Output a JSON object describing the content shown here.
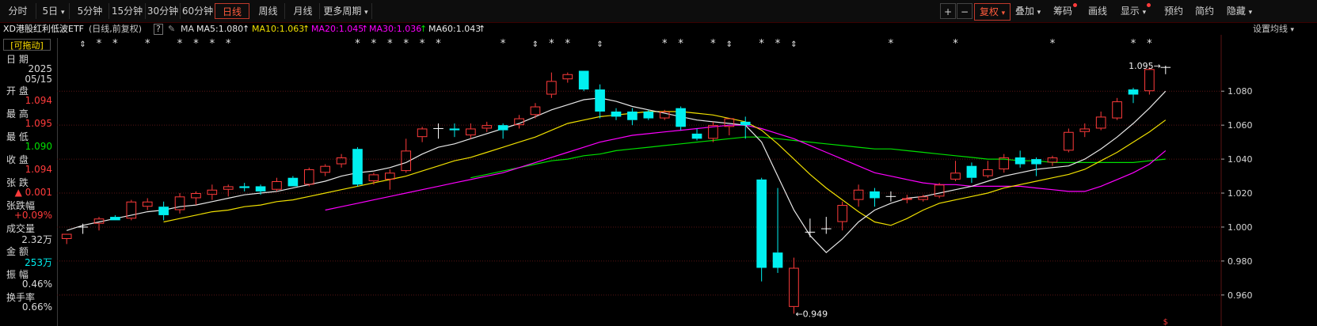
{
  "toolbar": {
    "periods": [
      "分时",
      "5日",
      "5分钟",
      "15分钟",
      "30分钟",
      "60分钟",
      "日线",
      "周线",
      "月线",
      "更多周期"
    ],
    "active_period": "日线",
    "plus_label": "+",
    "minus_label": "−",
    "fuquan_label": "复权",
    "overlay_label": "叠加",
    "chips_label": "筹码",
    "drawline_label": "画线",
    "display_label": "显示",
    "memo_label": "预约",
    "simple_label": "简约",
    "hide_label": "隐藏"
  },
  "ma_bar": {
    "title": "XD港股红利低波ETF",
    "mode": "(日线,前复权)",
    "help": "?",
    "ma_label": "MA",
    "ma5": "MA5:1.080",
    "ma10": "MA10:1.063",
    "ma20": "MA20:1.045",
    "ma30": "MA30:1.036",
    "ma60": "MA60:1.043",
    "settings": "设置均线"
  },
  "info_panel": {
    "drag": "[可拖动]",
    "date_label": "日  期",
    "date_year": "2025",
    "date_md": "05/15",
    "open_label": "开  盘",
    "open": "1.094",
    "high_label": "最  高",
    "high": "1.095",
    "low_label": "最  低",
    "low": "1.090",
    "close_label": "收  盘",
    "close": "1.094",
    "change_label": "张  跌",
    "change": "▲ 0.001",
    "pct_label": "张跌幅",
    "pct": "+0.09%",
    "vol_label": "成交量",
    "vol": "2.32万",
    "amount_label": "金  额",
    "amount": "253万",
    "amp_label": "振  幅",
    "amp": "0.46%",
    "turnover_label": "换手率",
    "turnover": "0.66%"
  },
  "colors": {
    "up": "#ff3b3b",
    "down": "#00f0f0",
    "flat": "#ffffff",
    "ma5": "#e8e8e8",
    "ma10": "#f0e000",
    "ma20": "#ff00ff",
    "ma60": "#00e000",
    "axis_text": "#d8d8d8",
    "active": "#ff5a3c"
  },
  "chart_data": {
    "type": "candlestick",
    "ylim": [
      0.952,
      1.102
    ],
    "yticks": [
      "1.080",
      "1.060",
      "1.040",
      "1.020",
      "1.000",
      "0.980",
      "0.960"
    ],
    "ytick_values": [
      1.08,
      1.06,
      1.04,
      1.02,
      1.0,
      0.98,
      0.96
    ],
    "max_label": "1.095",
    "max_value": 1.095,
    "min_label": "0.949",
    "min_value": 0.949,
    "s_marker": "$",
    "candles": [
      {
        "o": 0.993,
        "h": 0.996,
        "l": 0.99,
        "c": 0.996
      },
      {
        "o": 1.0,
        "h": 1.002,
        "l": 0.996,
        "c": 1.0
      },
      {
        "o": 1.002,
        "h": 1.006,
        "l": 0.998,
        "c": 1.005
      },
      {
        "o": 1.006,
        "h": 1.007,
        "l": 1.004,
        "c": 1.004
      },
      {
        "o": 1.005,
        "h": 1.016,
        "l": 1.004,
        "c": 1.015
      },
      {
        "o": 1.012,
        "h": 1.017,
        "l": 1.01,
        "c": 1.015
      },
      {
        "o": 1.012,
        "h": 1.015,
        "l": 1.004,
        "c": 1.007
      },
      {
        "o": 1.01,
        "h": 1.02,
        "l": 1.008,
        "c": 1.018
      },
      {
        "o": 1.017,
        "h": 1.021,
        "l": 1.013,
        "c": 1.02
      },
      {
        "o": 1.019,
        "h": 1.025,
        "l": 1.016,
        "c": 1.022
      },
      {
        "o": 1.022,
        "h": 1.025,
        "l": 1.018,
        "c": 1.024
      },
      {
        "o": 1.024,
        "h": 1.026,
        "l": 1.021,
        "c": 1.023
      },
      {
        "o": 1.024,
        "h": 1.025,
        "l": 1.019,
        "c": 1.021
      },
      {
        "o": 1.022,
        "h": 1.029,
        "l": 1.021,
        "c": 1.027
      },
      {
        "o": 1.029,
        "h": 1.03,
        "l": 1.024,
        "c": 1.024
      },
      {
        "o": 1.025,
        "h": 1.035,
        "l": 1.024,
        "c": 1.034
      },
      {
        "o": 1.032,
        "h": 1.037,
        "l": 1.03,
        "c": 1.036
      },
      {
        "o": 1.037,
        "h": 1.043,
        "l": 1.035,
        "c": 1.041
      },
      {
        "o": 1.046,
        "h": 1.047,
        "l": 1.024,
        "c": 1.025
      },
      {
        "o": 1.027,
        "h": 1.032,
        "l": 1.025,
        "c": 1.031
      },
      {
        "o": 1.028,
        "h": 1.034,
        "l": 1.022,
        "c": 1.032
      },
      {
        "o": 1.033,
        "h": 1.052,
        "l": 1.032,
        "c": 1.045
      },
      {
        "o": 1.053,
        "h": 1.059,
        "l": 1.05,
        "c": 1.058
      },
      {
        "o": 1.058,
        "h": 1.061,
        "l": 1.052,
        "c": 1.058
      },
      {
        "o": 1.058,
        "h": 1.061,
        "l": 1.053,
        "c": 1.057
      },
      {
        "o": 1.054,
        "h": 1.061,
        "l": 1.052,
        "c": 1.058
      },
      {
        "o": 1.058,
        "h": 1.062,
        "l": 1.056,
        "c": 1.06
      },
      {
        "o": 1.06,
        "h": 1.061,
        "l": 1.052,
        "c": 1.057
      },
      {
        "o": 1.06,
        "h": 1.066,
        "l": 1.058,
        "c": 1.064
      },
      {
        "o": 1.066,
        "h": 1.073,
        "l": 1.064,
        "c": 1.071
      },
      {
        "o": 1.078,
        "h": 1.091,
        "l": 1.076,
        "c": 1.086
      },
      {
        "o": 1.087,
        "h": 1.091,
        "l": 1.085,
        "c": 1.09
      },
      {
        "o": 1.092,
        "h": 1.092,
        "l": 1.08,
        "c": 1.081
      },
      {
        "o": 1.081,
        "h": 1.084,
        "l": 1.064,
        "c": 1.068
      },
      {
        "o": 1.068,
        "h": 1.07,
        "l": 1.063,
        "c": 1.065
      },
      {
        "o": 1.068,
        "h": 1.07,
        "l": 1.06,
        "c": 1.063
      },
      {
        "o": 1.068,
        "h": 1.069,
        "l": 1.063,
        "c": 1.064
      },
      {
        "o": 1.064,
        "h": 1.069,
        "l": 1.063,
        "c": 1.068
      },
      {
        "o": 1.07,
        "h": 1.071,
        "l": 1.057,
        "c": 1.059
      },
      {
        "o": 1.055,
        "h": 1.058,
        "l": 1.051,
        "c": 1.052
      },
      {
        "o": 1.052,
        "h": 1.062,
        "l": 1.05,
        "c": 1.06
      },
      {
        "o": 1.059,
        "h": 1.064,
        "l": 1.054,
        "c": 1.064
      },
      {
        "o": 1.062,
        "h": 1.065,
        "l": 1.052,
        "c": 1.06
      },
      {
        "o": 1.028,
        "h": 1.029,
        "l": 0.968,
        "c": 0.976
      },
      {
        "o": 0.985,
        "h": 1.023,
        "l": 0.973,
        "c": 0.976
      },
      {
        "o": 0.953,
        "h": 0.982,
        "l": 0.949,
        "c": 0.976
      },
      {
        "o": 0.997,
        "h": 1.005,
        "l": 0.994,
        "c": 0.997
      },
      {
        "o": 0.999,
        "h": 1.006,
        "l": 0.996,
        "c": 0.999
      },
      {
        "o": 1.003,
        "h": 1.015,
        "l": 0.998,
        "c": 1.013
      },
      {
        "o": 1.016,
        "h": 1.025,
        "l": 1.012,
        "c": 1.022
      },
      {
        "o": 1.021,
        "h": 1.023,
        "l": 1.012,
        "c": 1.017
      },
      {
        "o": 1.018,
        "h": 1.021,
        "l": 1.015,
        "c": 1.018
      },
      {
        "o": 1.016,
        "h": 1.019,
        "l": 1.014,
        "c": 1.017
      },
      {
        "o": 1.016,
        "h": 1.019,
        "l": 1.015,
        "c": 1.018
      },
      {
        "o": 1.018,
        "h": 1.026,
        "l": 1.017,
        "c": 1.025
      },
      {
        "o": 1.028,
        "h": 1.039,
        "l": 1.027,
        "c": 1.032
      },
      {
        "o": 1.036,
        "h": 1.038,
        "l": 1.026,
        "c": 1.029
      },
      {
        "o": 1.03,
        "h": 1.039,
        "l": 1.029,
        "c": 1.034
      },
      {
        "o": 1.034,
        "h": 1.043,
        "l": 1.032,
        "c": 1.041
      },
      {
        "o": 1.041,
        "h": 1.045,
        "l": 1.035,
        "c": 1.037
      },
      {
        "o": 1.04,
        "h": 1.041,
        "l": 1.03,
        "c": 1.037
      },
      {
        "o": 1.038,
        "h": 1.042,
        "l": 1.036,
        "c": 1.041
      },
      {
        "o": 1.045,
        "h": 1.058,
        "l": 1.044,
        "c": 1.056
      },
      {
        "o": 1.056,
        "h": 1.061,
        "l": 1.053,
        "c": 1.058
      },
      {
        "o": 1.058,
        "h": 1.068,
        "l": 1.057,
        "c": 1.065
      },
      {
        "o": 1.064,
        "h": 1.076,
        "l": 1.063,
        "c": 1.074
      },
      {
        "o": 1.081,
        "h": 1.082,
        "l": 1.073,
        "c": 1.078
      },
      {
        "o": 1.08,
        "h": 1.094,
        "l": 1.078,
        "c": 1.093
      },
      {
        "o": 1.094,
        "h": 1.095,
        "l": 1.09,
        "c": 1.094
      }
    ],
    "ma5": [
      0.998,
      1.001,
      1.003,
      1.005,
      1.007,
      1.009,
      1.01,
      1.012,
      1.013,
      1.015,
      1.017,
      1.019,
      1.02,
      1.021,
      1.023,
      1.025,
      1.027,
      1.03,
      1.032,
      1.033,
      1.035,
      1.038,
      1.043,
      1.047,
      1.049,
      1.052,
      1.055,
      1.058,
      1.061,
      1.065,
      1.069,
      1.072,
      1.075,
      1.076,
      1.074,
      1.071,
      1.069,
      1.067,
      1.065,
      1.063,
      1.062,
      1.061,
      1.06,
      1.05,
      1.03,
      1.01,
      0.995,
      0.985,
      0.993,
      1.003,
      1.01,
      1.014,
      1.017,
      1.018,
      1.02,
      1.022,
      1.024,
      1.027,
      1.03,
      1.032,
      1.034,
      1.035,
      1.036,
      1.04,
      1.046,
      1.053,
      1.061,
      1.07,
      1.08
    ],
    "ma10": [
      null,
      null,
      null,
      null,
      null,
      null,
      1.003,
      1.005,
      1.007,
      1.009,
      1.01,
      1.012,
      1.013,
      1.015,
      1.016,
      1.018,
      1.02,
      1.022,
      1.024,
      1.026,
      1.028,
      1.03,
      1.033,
      1.036,
      1.039,
      1.041,
      1.044,
      1.047,
      1.05,
      1.053,
      1.057,
      1.061,
      1.063,
      1.065,
      1.066,
      1.067,
      1.068,
      1.068,
      1.068,
      1.067,
      1.066,
      1.064,
      1.062,
      1.057,
      1.049,
      1.04,
      1.031,
      1.023,
      1.016,
      1.009,
      1.003,
      1.001,
      1.005,
      1.01,
      1.014,
      1.016,
      1.018,
      1.02,
      1.023,
      1.025,
      1.027,
      1.029,
      1.031,
      1.034,
      1.039,
      1.044,
      1.05,
      1.056,
      1.063
    ],
    "ma20": [
      null,
      null,
      null,
      null,
      null,
      null,
      null,
      null,
      null,
      null,
      null,
      null,
      null,
      null,
      null,
      null,
      1.01,
      1.012,
      1.014,
      1.016,
      1.018,
      1.02,
      1.022,
      1.024,
      1.026,
      1.028,
      1.03,
      1.032,
      1.035,
      1.038,
      1.041,
      1.044,
      1.047,
      1.05,
      1.052,
      1.054,
      1.055,
      1.056,
      1.057,
      1.058,
      1.059,
      1.06,
      1.06,
      1.058,
      1.055,
      1.052,
      1.048,
      1.044,
      1.04,
      1.036,
      1.032,
      1.03,
      1.028,
      1.026,
      1.025,
      1.025,
      1.024,
      1.024,
      1.024,
      1.024,
      1.023,
      1.022,
      1.021,
      1.021,
      1.024,
      1.028,
      1.032,
      1.037,
      1.045
    ],
    "ma60": [
      null,
      null,
      null,
      null,
      null,
      null,
      null,
      null,
      null,
      null,
      null,
      null,
      null,
      null,
      null,
      null,
      null,
      null,
      null,
      null,
      null,
      null,
      null,
      null,
      null,
      1.029,
      1.031,
      1.033,
      1.035,
      1.037,
      1.039,
      1.04,
      1.042,
      1.043,
      1.045,
      1.046,
      1.047,
      1.048,
      1.049,
      1.05,
      1.051,
      1.052,
      1.053,
      1.053,
      1.052,
      1.051,
      1.05,
      1.049,
      1.048,
      1.047,
      1.046,
      1.046,
      1.045,
      1.044,
      1.043,
      1.042,
      1.041,
      1.04,
      1.04,
      1.039,
      1.039,
      1.038,
      1.038,
      1.038,
      1.038,
      1.038,
      1.038,
      1.039,
      1.04
    ],
    "markers": [
      {
        "i": 1,
        "s": "⇕"
      },
      {
        "i": 2,
        "s": "*"
      },
      {
        "i": 3,
        "s": "*"
      },
      {
        "i": 5,
        "s": "*"
      },
      {
        "i": 7,
        "s": "*"
      },
      {
        "i": 8,
        "s": "*"
      },
      {
        "i": 9,
        "s": "*"
      },
      {
        "i": 10,
        "s": "*"
      },
      {
        "i": 18,
        "s": "*"
      },
      {
        "i": 19,
        "s": "*"
      },
      {
        "i": 20,
        "s": "*"
      },
      {
        "i": 21,
        "s": "*"
      },
      {
        "i": 22,
        "s": "*"
      },
      {
        "i": 23,
        "s": "*"
      },
      {
        "i": 27,
        "s": "*"
      },
      {
        "i": 29,
        "s": "⇕"
      },
      {
        "i": 30,
        "s": "*"
      },
      {
        "i": 31,
        "s": "*"
      },
      {
        "i": 33,
        "s": "⇕"
      },
      {
        "i": 37,
        "s": "*"
      },
      {
        "i": 38,
        "s": "*"
      },
      {
        "i": 40,
        "s": "*"
      },
      {
        "i": 41,
        "s": "⇕"
      },
      {
        "i": 43,
        "s": "*"
      },
      {
        "i": 44,
        "s": "*"
      },
      {
        "i": 45,
        "s": "⇕"
      },
      {
        "i": 51,
        "s": "*"
      },
      {
        "i": 55,
        "s": "*"
      },
      {
        "i": 61,
        "s": "*"
      },
      {
        "i": 66,
        "s": "*"
      },
      {
        "i": 67,
        "s": "*"
      }
    ]
  }
}
